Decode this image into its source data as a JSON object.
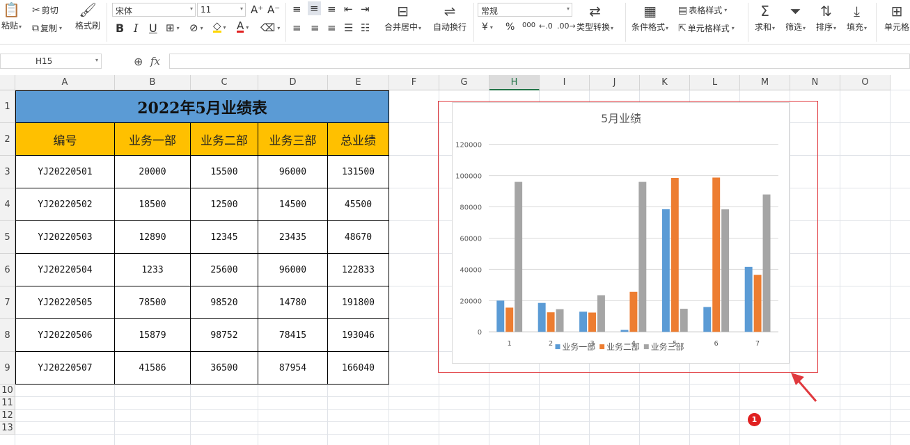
{
  "ribbon": {
    "paste": "粘贴",
    "cut": "剪切",
    "copy": "复制",
    "format_painter": "格式刷",
    "font_name": "宋体",
    "font_size": "11",
    "merge_center": "合并居中",
    "wrap_text": "自动换行",
    "number_format": "常规",
    "type_convert": "类型转换",
    "conditional_format": "条件格式",
    "table_style": "表格样式",
    "cell_style": "单元格样式",
    "sum": "求和",
    "filter": "筛选",
    "sort": "排序",
    "fill": "填充",
    "cell": "单元格",
    "currency_symbol": "¥",
    "percent_symbol": "%",
    "thousands_symbol": "000"
  },
  "formula_bar": {
    "name_box": "H15",
    "fx_label": "fx",
    "formula": ""
  },
  "columns": [
    "A",
    "B",
    "C",
    "D",
    "E",
    "F",
    "G",
    "H",
    "I",
    "J",
    "K",
    "L",
    "M",
    "N",
    "O"
  ],
  "selected_column": "H",
  "rows": [
    "1",
    "2",
    "3",
    "4",
    "5",
    "6",
    "7",
    "8",
    "9",
    "10",
    "11",
    "12",
    "13"
  ],
  "table": {
    "title": "2022年5月业绩表",
    "headers": [
      "编号",
      "业务一部",
      "业务二部",
      "业务三部",
      "总业绩"
    ],
    "data": [
      [
        "YJ20220501",
        "20000",
        "15500",
        "96000",
        "131500"
      ],
      [
        "YJ20220502",
        "18500",
        "12500",
        "14500",
        "45500"
      ],
      [
        "YJ20220503",
        "12890",
        "12345",
        "23435",
        "48670"
      ],
      [
        "YJ20220504",
        "1233",
        "25600",
        "96000",
        "122833"
      ],
      [
        "YJ20220505",
        "78500",
        "98520",
        "14780",
        "191800"
      ],
      [
        "YJ20220506",
        "15879",
        "98752",
        "78415",
        "193046"
      ],
      [
        "YJ20220507",
        "41586",
        "36500",
        "87954",
        "166040"
      ]
    ]
  },
  "chart_data": {
    "type": "bar",
    "title": "5月业绩",
    "categories": [
      "1",
      "2",
      "3",
      "4",
      "5",
      "6",
      "7"
    ],
    "series": [
      {
        "name": "业务一部",
        "color": "#5b9bd5",
        "values": [
          20000,
          18500,
          12890,
          1233,
          78500,
          15879,
          41586
        ]
      },
      {
        "name": "业务二部",
        "color": "#ed7d31",
        "values": [
          15500,
          12500,
          12345,
          25600,
          98520,
          98752,
          36500
        ]
      },
      {
        "name": "业务三部",
        "color": "#a5a5a5",
        "values": [
          96000,
          14500,
          23435,
          96000,
          14780,
          78415,
          87954
        ]
      }
    ],
    "ylim": [
      0,
      120000
    ],
    "yticks": [
      "0",
      "20000",
      "40000",
      "60000",
      "80000",
      "100000",
      "120000"
    ],
    "grid": true,
    "legend": "bottom"
  },
  "annotation": {
    "badge": "1",
    "highlight_color": "#e0393e"
  }
}
